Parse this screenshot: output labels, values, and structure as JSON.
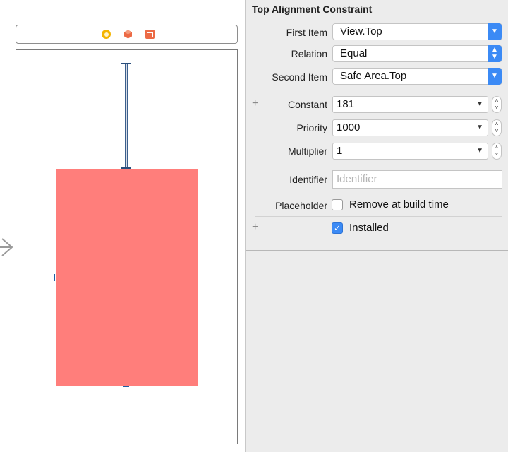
{
  "canvas": {
    "dock_icons": [
      "view-controller-icon",
      "first-responder-icon",
      "exit-icon"
    ],
    "view_color": "#ff7e7b",
    "constraint_color": "#1e5fa3"
  },
  "inspector": {
    "title": "Top Alignment Constraint",
    "first_item": {
      "label": "First Item",
      "value": "View.Top"
    },
    "relation": {
      "label": "Relation",
      "value": "Equal"
    },
    "second_item": {
      "label": "Second Item",
      "value": "Safe Area.Top"
    },
    "constant": {
      "label": "Constant",
      "value": "181"
    },
    "priority": {
      "label": "Priority",
      "value": "1000"
    },
    "multiplier": {
      "label": "Multiplier",
      "value": "1"
    },
    "identifier": {
      "label": "Identifier",
      "placeholder": "Identifier"
    },
    "placeholder": {
      "label": "Placeholder",
      "checkbox_label": "Remove at build time",
      "checked": false
    },
    "installed": {
      "checkbox_label": "Installed",
      "checked": true
    },
    "accent_color": "#3b8af5"
  }
}
